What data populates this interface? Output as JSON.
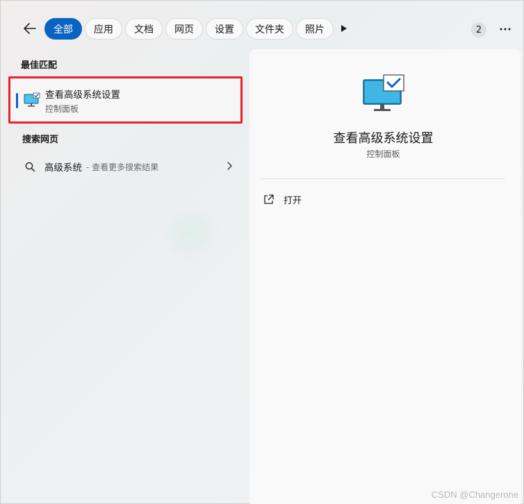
{
  "tabs": [
    {
      "label": "全部",
      "active": true
    },
    {
      "label": "应用"
    },
    {
      "label": "文档"
    },
    {
      "label": "网页"
    },
    {
      "label": "设置"
    },
    {
      "label": "文件夹"
    },
    {
      "label": "照片"
    }
  ],
  "toolbar": {
    "back_icon": "back-arrow-icon",
    "more_results_icon": "play-icon",
    "count_badge": "2",
    "more_icon": "ellipsis-icon"
  },
  "best_match": {
    "section_title": "最佳匹配",
    "title": "查看高级系统设置",
    "subtitle": "控制面板",
    "icon": "monitor-checkmark-icon",
    "highlight_color": "#e8212d"
  },
  "web_search": {
    "section_title": "搜索网页",
    "query": "高级系统",
    "hint": "- 查看更多搜索结果",
    "icon": "search-icon"
  },
  "detail": {
    "title": "查看高级系统设置",
    "subtitle": "控制面板",
    "actions": [
      {
        "label": "打开",
        "icon": "open-external-icon"
      }
    ]
  },
  "watermark": "CSDN @Changerone",
  "colors": {
    "accent": "#0b63c1",
    "highlight_border": "#e8212d"
  }
}
